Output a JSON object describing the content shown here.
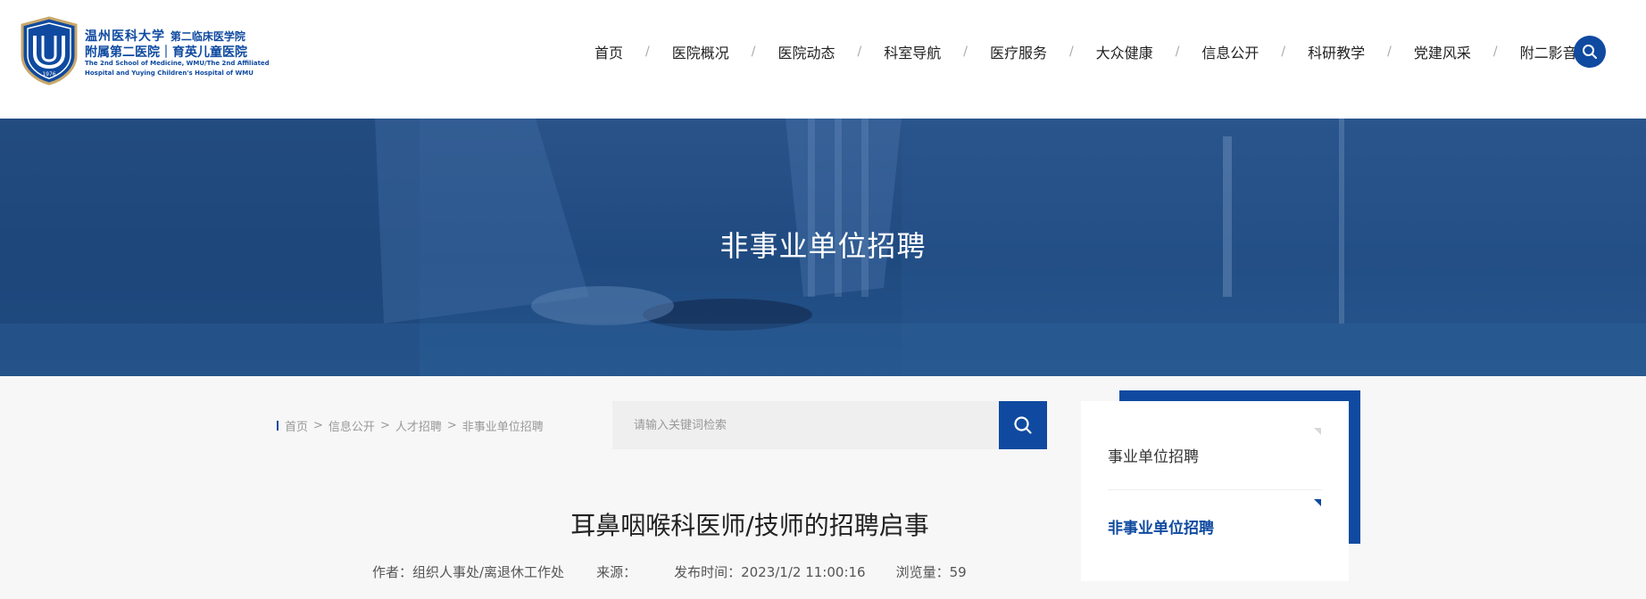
{
  "header": {
    "logo": {
      "line1": "温州医科大学",
      "line1_sub": "第二临床医学院",
      "line2": "附属第二医院｜育英儿童医院",
      "line3": "The 2nd School of Medicine, WMU/The 2nd Affiliated",
      "line4": "Hospital and Yuying Children's Hospital of WMU",
      "seal_year": "1976"
    },
    "nav": [
      "首页",
      "医院概况",
      "医院动态",
      "科室导航",
      "医疗服务",
      "大众健康",
      "信息公开",
      "科研教学",
      "党建风采",
      "附二影音"
    ],
    "nav_separator": "/"
  },
  "banner": {
    "title": "非事业单位招聘"
  },
  "breadcrumb": [
    "首页",
    "信息公开",
    "人才招聘",
    "非事业单位招聘"
  ],
  "breadcrumb_separator": ">",
  "search": {
    "placeholder": "请输入关键词检索",
    "value": ""
  },
  "article": {
    "title": "耳鼻咽喉科医师/技师的招聘启事",
    "meta": {
      "author": "作者：组织人事处/离退休工作处",
      "source": "来源：",
      "published": "发布时间：2023/1/2 11:00:16",
      "views": "浏览量：59"
    }
  },
  "sidebar": {
    "items": [
      {
        "label": "事业单位招聘",
        "active": false
      },
      {
        "label": "非事业单位招聘",
        "active": true
      }
    ]
  },
  "colors": {
    "brand": "#0f4aa0",
    "banner": "#1f4a80",
    "background": "#f7f7f7"
  },
  "icons": {
    "search": "search-icon",
    "seal": "university-seal-icon"
  }
}
